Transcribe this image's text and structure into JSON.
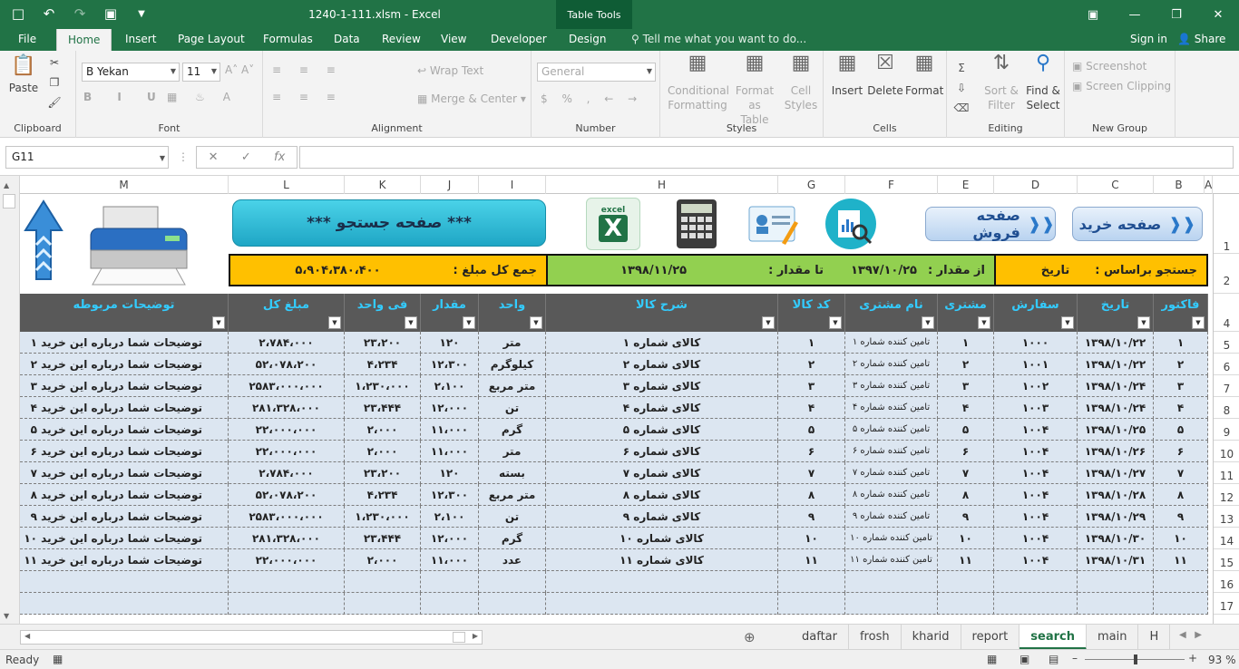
{
  "window": {
    "title": "1240-1-111.xlsm - Excel",
    "table_tools": "Table Tools"
  },
  "ribbon_tabs": [
    "File",
    "Home",
    "Insert",
    "Page Layout",
    "Formulas",
    "Data",
    "Review",
    "View",
    "Developer",
    "Design"
  ],
  "tell_me": "Tell me what you want to do...",
  "sign_in": "Sign in",
  "share": "Share",
  "ribbon": {
    "clipboard": {
      "label": "Clipboard",
      "paste": "Paste"
    },
    "font": {
      "label": "Font",
      "name": "B Yekan",
      "size": "11"
    },
    "alignment": {
      "label": "Alignment",
      "wrap": "Wrap Text",
      "merge": "Merge & Center"
    },
    "number": {
      "label": "Number",
      "format": "General"
    },
    "styles": {
      "label": "Styles",
      "conditional": "Conditional",
      "conditional2": "Formatting",
      "format_table": "Format as",
      "format_table2": "Table",
      "cell_styles": "Cell",
      "cell_styles2": "Styles"
    },
    "cells": {
      "label": "Cells",
      "insert": "Insert",
      "delete": "Delete",
      "format": "Format"
    },
    "editing": {
      "label": "Editing",
      "sort": "Sort &",
      "sort2": "Filter",
      "find": "Find &",
      "find2": "Select"
    },
    "newgroup": {
      "label": "New Group",
      "screenshot": "Screenshot",
      "clipping": "Screen Clipping"
    }
  },
  "formula_bar": {
    "name_box": "G11",
    "fx": "fx",
    "value": ""
  },
  "columns": [
    "M",
    "L",
    "K",
    "J",
    "I",
    "H",
    "G",
    "F",
    "E",
    "D",
    "C",
    "B",
    "A"
  ],
  "rows": [
    "1",
    "2",
    "4",
    "5",
    "6",
    "7",
    "8",
    "9",
    "10",
    "11",
    "12",
    "13",
    "14",
    "15",
    "16",
    "17"
  ],
  "buttons": {
    "buy": "صفحه خرید",
    "sell": "صفحه فروش",
    "search": "*** صفحه جستجو ***",
    "excel": "excel"
  },
  "filter_strip": {
    "search_by": "جستجو براساس :",
    "date": "تاریخ",
    "from": "از مقدار :",
    "from_val": "۱۳۹۷/۱۰/۲۵",
    "to": "تا مقدار :",
    "to_val": "۱۳۹۸/۱۱/۲۵",
    "total_label": "جمع کل مبلغ :",
    "total_val": "۵،۹۰۴،۳۸۰،۴۰۰"
  },
  "table": {
    "headers": [
      "فاکتور",
      "تاریخ",
      "سفارش",
      "مشتری",
      "نام مشتری",
      "کد کالا",
      "شرح کالا",
      "واحد",
      "مقدار",
      "فی واحد",
      "مبلغ کل",
      "توضیحات مربوطه"
    ],
    "rows": [
      [
        "۱",
        "۱۳۹۸/۱۰/۲۲",
        "۱۰۰۰",
        "۱",
        "تامین کننده شماره ۱",
        "۱",
        "کالای شماره ۱",
        "متر",
        "۱۲۰",
        "۲۳،۲۰۰",
        "۲،۷۸۴،۰۰۰",
        "توضیحات شما درباره این خرید ۱"
      ],
      [
        "۲",
        "۱۳۹۸/۱۰/۲۲",
        "۱۰۰۱",
        "۲",
        "تامین کننده شماره ۲",
        "۲",
        "کالای شماره ۲",
        "کیلوگرم",
        "۱۲،۳۰۰",
        "۴،۲۳۴",
        "۵۲،۰۷۸،۲۰۰",
        "توضیحات شما درباره این خرید ۲"
      ],
      [
        "۳",
        "۱۳۹۸/۱۰/۲۴",
        "۱۰۰۲",
        "۳",
        "تامین کننده شماره ۳",
        "۳",
        "کالای شماره ۳",
        "متر مربع",
        "۲،۱۰۰",
        "۱،۲۳۰،۰۰۰",
        "۲۵۸۳،۰۰۰،۰۰۰",
        "توضیحات شما درباره این خرید ۳"
      ],
      [
        "۴",
        "۱۳۹۸/۱۰/۲۴",
        "۱۰۰۳",
        "۴",
        "تامین کننده شماره ۴",
        "۴",
        "کالای شماره ۴",
        "تن",
        "۱۲،۰۰۰",
        "۲۳،۴۴۴",
        "۲۸۱،۳۲۸،۰۰۰",
        "توضیحات شما درباره این خرید ۴"
      ],
      [
        "۵",
        "۱۳۹۸/۱۰/۲۵",
        "۱۰۰۴",
        "۵",
        "تامین کننده شماره ۵",
        "۵",
        "کالای شماره ۵",
        "گرم",
        "۱۱،۰۰۰",
        "۲،۰۰۰",
        "۲۲،۰۰۰،۰۰۰",
        "توضیحات شما درباره این خرید ۵"
      ],
      [
        "۶",
        "۱۳۹۸/۱۰/۲۶",
        "۱۰۰۴",
        "۶",
        "تامین کننده شماره ۶",
        "۶",
        "کالای شماره ۶",
        "متر",
        "۱۱،۰۰۰",
        "۲،۰۰۰",
        "۲۲،۰۰۰،۰۰۰",
        "توضیحات شما درباره این خرید ۶"
      ],
      [
        "۷",
        "۱۳۹۸/۱۰/۲۷",
        "۱۰۰۴",
        "۷",
        "تامین کننده شماره ۷",
        "۷",
        "کالای شماره ۷",
        "بسته",
        "۱۲۰",
        "۲۳،۲۰۰",
        "۲،۷۸۴،۰۰۰",
        "توضیحات شما درباره این خرید ۷"
      ],
      [
        "۸",
        "۱۳۹۸/۱۰/۲۸",
        "۱۰۰۴",
        "۸",
        "تامین کننده شماره ۸",
        "۸",
        "کالای شماره ۸",
        "متر مربع",
        "۱۲،۳۰۰",
        "۴،۲۳۴",
        "۵۲،۰۷۸،۲۰۰",
        "توضیحات شما درباره این خرید ۸"
      ],
      [
        "۹",
        "۱۳۹۸/۱۰/۲۹",
        "۱۰۰۴",
        "۹",
        "تامین کننده شماره ۹",
        "۹",
        "کالای شماره ۹",
        "تن",
        "۲،۱۰۰",
        "۱،۲۳۰،۰۰۰",
        "۲۵۸۳،۰۰۰،۰۰۰",
        "توضیحات شما درباره این خرید ۹"
      ],
      [
        "۱۰",
        "۱۳۹۸/۱۰/۳۰",
        "۱۰۰۴",
        "۱۰",
        "تامین کننده شماره ۱۰",
        "۱۰",
        "کالای شماره ۱۰",
        "گرم",
        "۱۲،۰۰۰",
        "۲۳،۴۴۴",
        "۲۸۱،۳۲۸،۰۰۰",
        "توضیحات شما درباره این خرید ۱۰"
      ],
      [
        "۱۱",
        "۱۳۹۸/۱۰/۳۱",
        "۱۰۰۴",
        "۱۱",
        "تامین کننده شماره ۱۱",
        "۱۱",
        "کالای شماره ۱۱",
        "عدد",
        "۱۱،۰۰۰",
        "۲،۰۰۰",
        "۲۲،۰۰۰،۰۰۰",
        "توضیحات شما درباره این خرید ۱۱"
      ]
    ]
  },
  "sheet_tabs": [
    "daftar",
    "frosh",
    "kharid",
    "report",
    "search",
    "main",
    "H"
  ],
  "active_sheet": "search",
  "status": {
    "ready": "Ready",
    "zoom": "93 %"
  }
}
